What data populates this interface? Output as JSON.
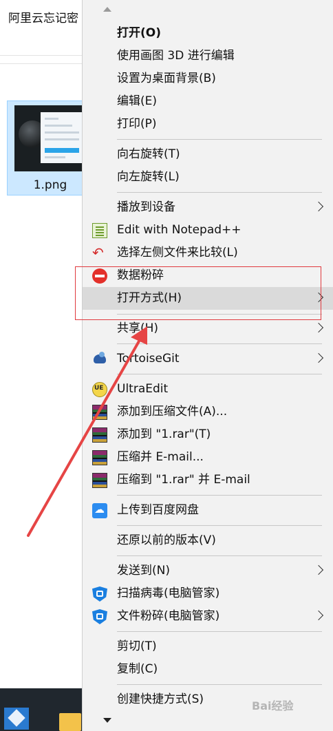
{
  "window": {
    "title": "阿里云忘记密",
    "file_name": "1.png"
  },
  "menu": {
    "items": [
      {
        "label": "打开(O)",
        "bold": true
      },
      {
        "label": "使用画图 3D 进行编辑"
      },
      {
        "label": "设置为桌面背景(B)"
      },
      {
        "label": "编辑(E)"
      },
      {
        "label": "打印(P)"
      },
      {
        "label": "向右旋转(T)"
      },
      {
        "label": "向左旋转(L)"
      },
      {
        "label": "播放到设备",
        "submenu": true
      },
      {
        "label": "Edit with Notepad++",
        "icon": "notepad-plus-plus-icon"
      },
      {
        "label": "选择左侧文件来比较(L)",
        "icon": "compare-icon"
      },
      {
        "label": "数据粉碎",
        "icon": "shred-icon"
      },
      {
        "label": "打开方式(H)",
        "submenu": true,
        "highlighted": true
      },
      {
        "label": "共享(H)",
        "submenu": true
      },
      {
        "label": "TortoiseGit",
        "submenu": true,
        "icon": "tortoisegit-icon"
      },
      {
        "label": "UltraEdit",
        "icon": "ultraedit-icon"
      },
      {
        "label": "添加到压缩文件(A)...",
        "icon": "winrar-icon"
      },
      {
        "label": "添加到 \"1.rar\"(T)",
        "icon": "winrar-icon"
      },
      {
        "label": "压缩并 E-mail...",
        "icon": "winrar-icon"
      },
      {
        "label": "压缩到 \"1.rar\" 并 E-mail",
        "icon": "winrar-icon"
      },
      {
        "label": "上传到百度网盘",
        "icon": "baidu-netdisk-icon"
      },
      {
        "label": "还原以前的版本(V)"
      },
      {
        "label": "发送到(N)",
        "submenu": true
      },
      {
        "label": "扫描病毒(电脑管家)",
        "icon": "pc-manager-shield-icon"
      },
      {
        "label": "文件粉碎(电脑管家)",
        "submenu": true,
        "icon": "pc-manager-shield-icon"
      },
      {
        "label": "剪切(T)"
      },
      {
        "label": "复制(C)"
      },
      {
        "label": "创建快捷方式(S)"
      }
    ]
  },
  "watermark": "Bai经验",
  "colors": {
    "menu_bg": "#f2f2f2",
    "hover_bg": "#dadada",
    "selection_bg": "#cce8ff",
    "annotation_red": "#e0393e"
  }
}
